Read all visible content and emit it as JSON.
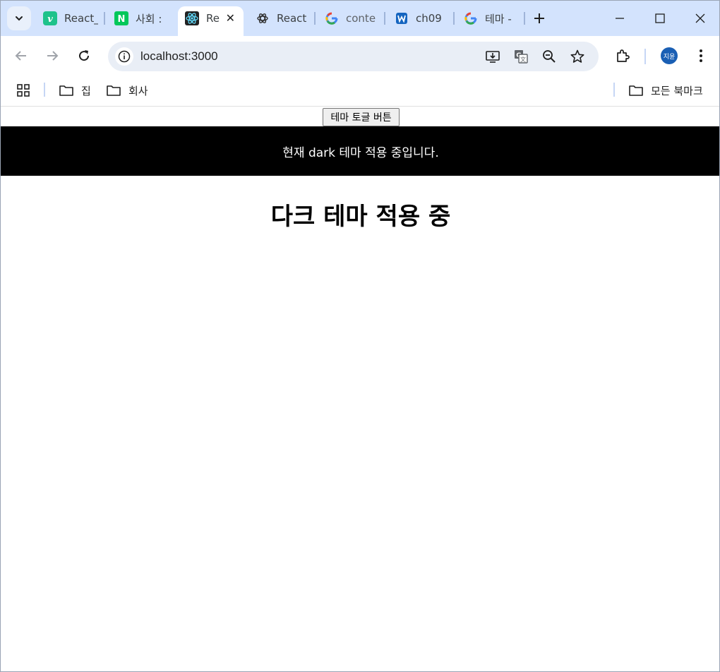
{
  "browser": {
    "tabs": [
      {
        "title": "React_",
        "favicon": "vue-v-icon",
        "active": false
      },
      {
        "title": "사회 :",
        "favicon": "naver-n-icon",
        "active": false
      },
      {
        "title": "Re",
        "favicon": "react-atom-icon",
        "active": true
      },
      {
        "title": "React",
        "favicon": "openai-icon",
        "active": false
      },
      {
        "title": "conte",
        "favicon": "google-g-icon",
        "active": false
      },
      {
        "title": "ch09 (",
        "favicon": "wiki-w-icon",
        "active": false
      },
      {
        "title": "테마 -",
        "favicon": "google-g-icon",
        "active": false
      }
    ],
    "address_bar": {
      "url": "localhost:3000"
    },
    "profile_initials": "지윤",
    "bookmarks": [
      {
        "label": "집"
      },
      {
        "label": "회사"
      }
    ],
    "all_bookmarks_label": "모든 북마크"
  },
  "page": {
    "toggle_button_label": "테마 토글 버튼",
    "banner_text": "현재 dark 테마 적용 중입니다.",
    "heading": "다크 테마 적용 중"
  },
  "colors": {
    "tabstrip_bg": "#d3e3fd",
    "banner_bg": "#000000",
    "banner_text": "#ffffff"
  }
}
